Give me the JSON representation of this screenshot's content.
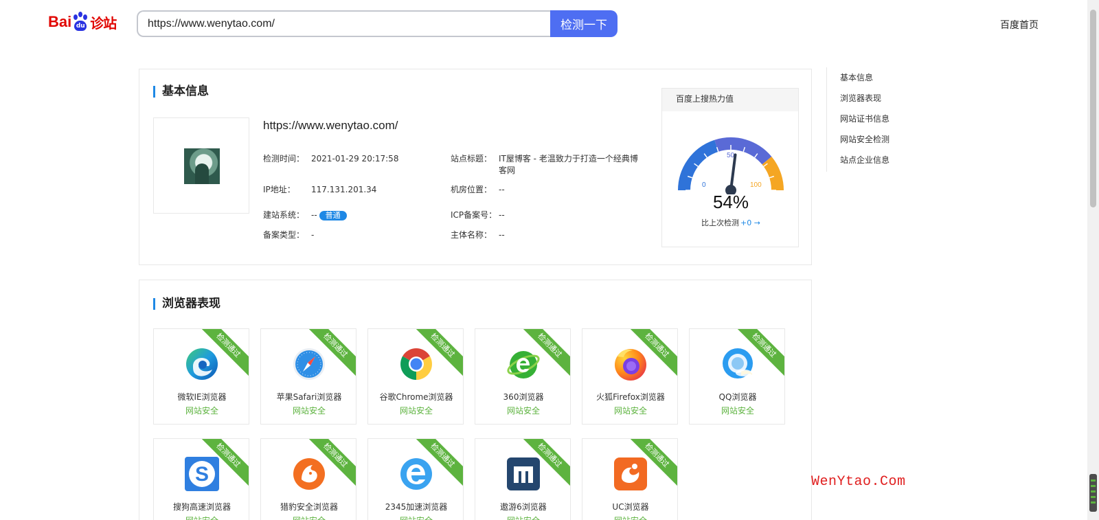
{
  "header": {
    "logo_bai": "Bai",
    "logo_du": "du",
    "logo_suffix": "诊站",
    "search_value": "https://www.wenytao.com/",
    "search_button": "检测一下",
    "home_link": "百度首页"
  },
  "sidenav": {
    "items": [
      {
        "label": "基本信息"
      },
      {
        "label": "浏览器表现"
      },
      {
        "label": "网站证书信息"
      },
      {
        "label": "网站安全检测"
      },
      {
        "label": "站点企业信息"
      }
    ]
  },
  "basic": {
    "title": "基本信息",
    "url": "https://www.wenytao.com/",
    "check_time_label": "检测时间：",
    "check_time": "2021-01-29 20:17:58",
    "site_title_label": "站点标题：",
    "site_title": "IT屋博客 - 老温致力于打造一个经典博客网",
    "ip_label": "IP地址：",
    "ip": "117.131.201.34",
    "location_label": "机房位置：",
    "location": "--",
    "cms_label": "建站系统：",
    "cms": "--",
    "cms_badge": "普通",
    "icp_label": "ICP备案号：",
    "icp": "--",
    "record_type_label": "备案类型：",
    "record_type": "-",
    "owner_label": "主体名称：",
    "owner": "--"
  },
  "gauge": {
    "title": "百度上搜热力值",
    "min_label": "0",
    "mid_label": "50",
    "max_label": "100",
    "value": 54,
    "value_text": "54%",
    "compare_label": "比上次检测",
    "compare_delta": "+0 →",
    "colors": {
      "blue": "#2f73d9",
      "violet": "#5a6ad6",
      "orange": "#f5a623"
    }
  },
  "browsers": {
    "title": "浏览器表现",
    "ribbon": "检测通过",
    "status": "网站安全",
    "status_color": "#5db33f",
    "items": [
      {
        "name": "微软IE浏览器",
        "icon": "edge-icon"
      },
      {
        "name": "苹果Safari浏览器",
        "icon": "safari-icon"
      },
      {
        "name": "谷歌Chrome浏览器",
        "icon": "chrome-icon"
      },
      {
        "name": "360浏览器",
        "icon": "360-browser-icon"
      },
      {
        "name": "火狐Firefox浏览器",
        "icon": "firefox-icon"
      },
      {
        "name": "QQ浏览器",
        "icon": "qq-browser-icon"
      },
      {
        "name": "搜狗高速浏览器",
        "icon": "sogou-browser-icon"
      },
      {
        "name": "猎豹安全浏览器",
        "icon": "liebao-browser-icon"
      },
      {
        "name": "2345加速浏览器",
        "icon": "2345-browser-icon"
      },
      {
        "name": "遨游6浏览器",
        "icon": "maxthon-icon"
      },
      {
        "name": "UC浏览器",
        "icon": "uc-browser-icon"
      }
    ]
  },
  "watermark": "WenYtao.Com"
}
